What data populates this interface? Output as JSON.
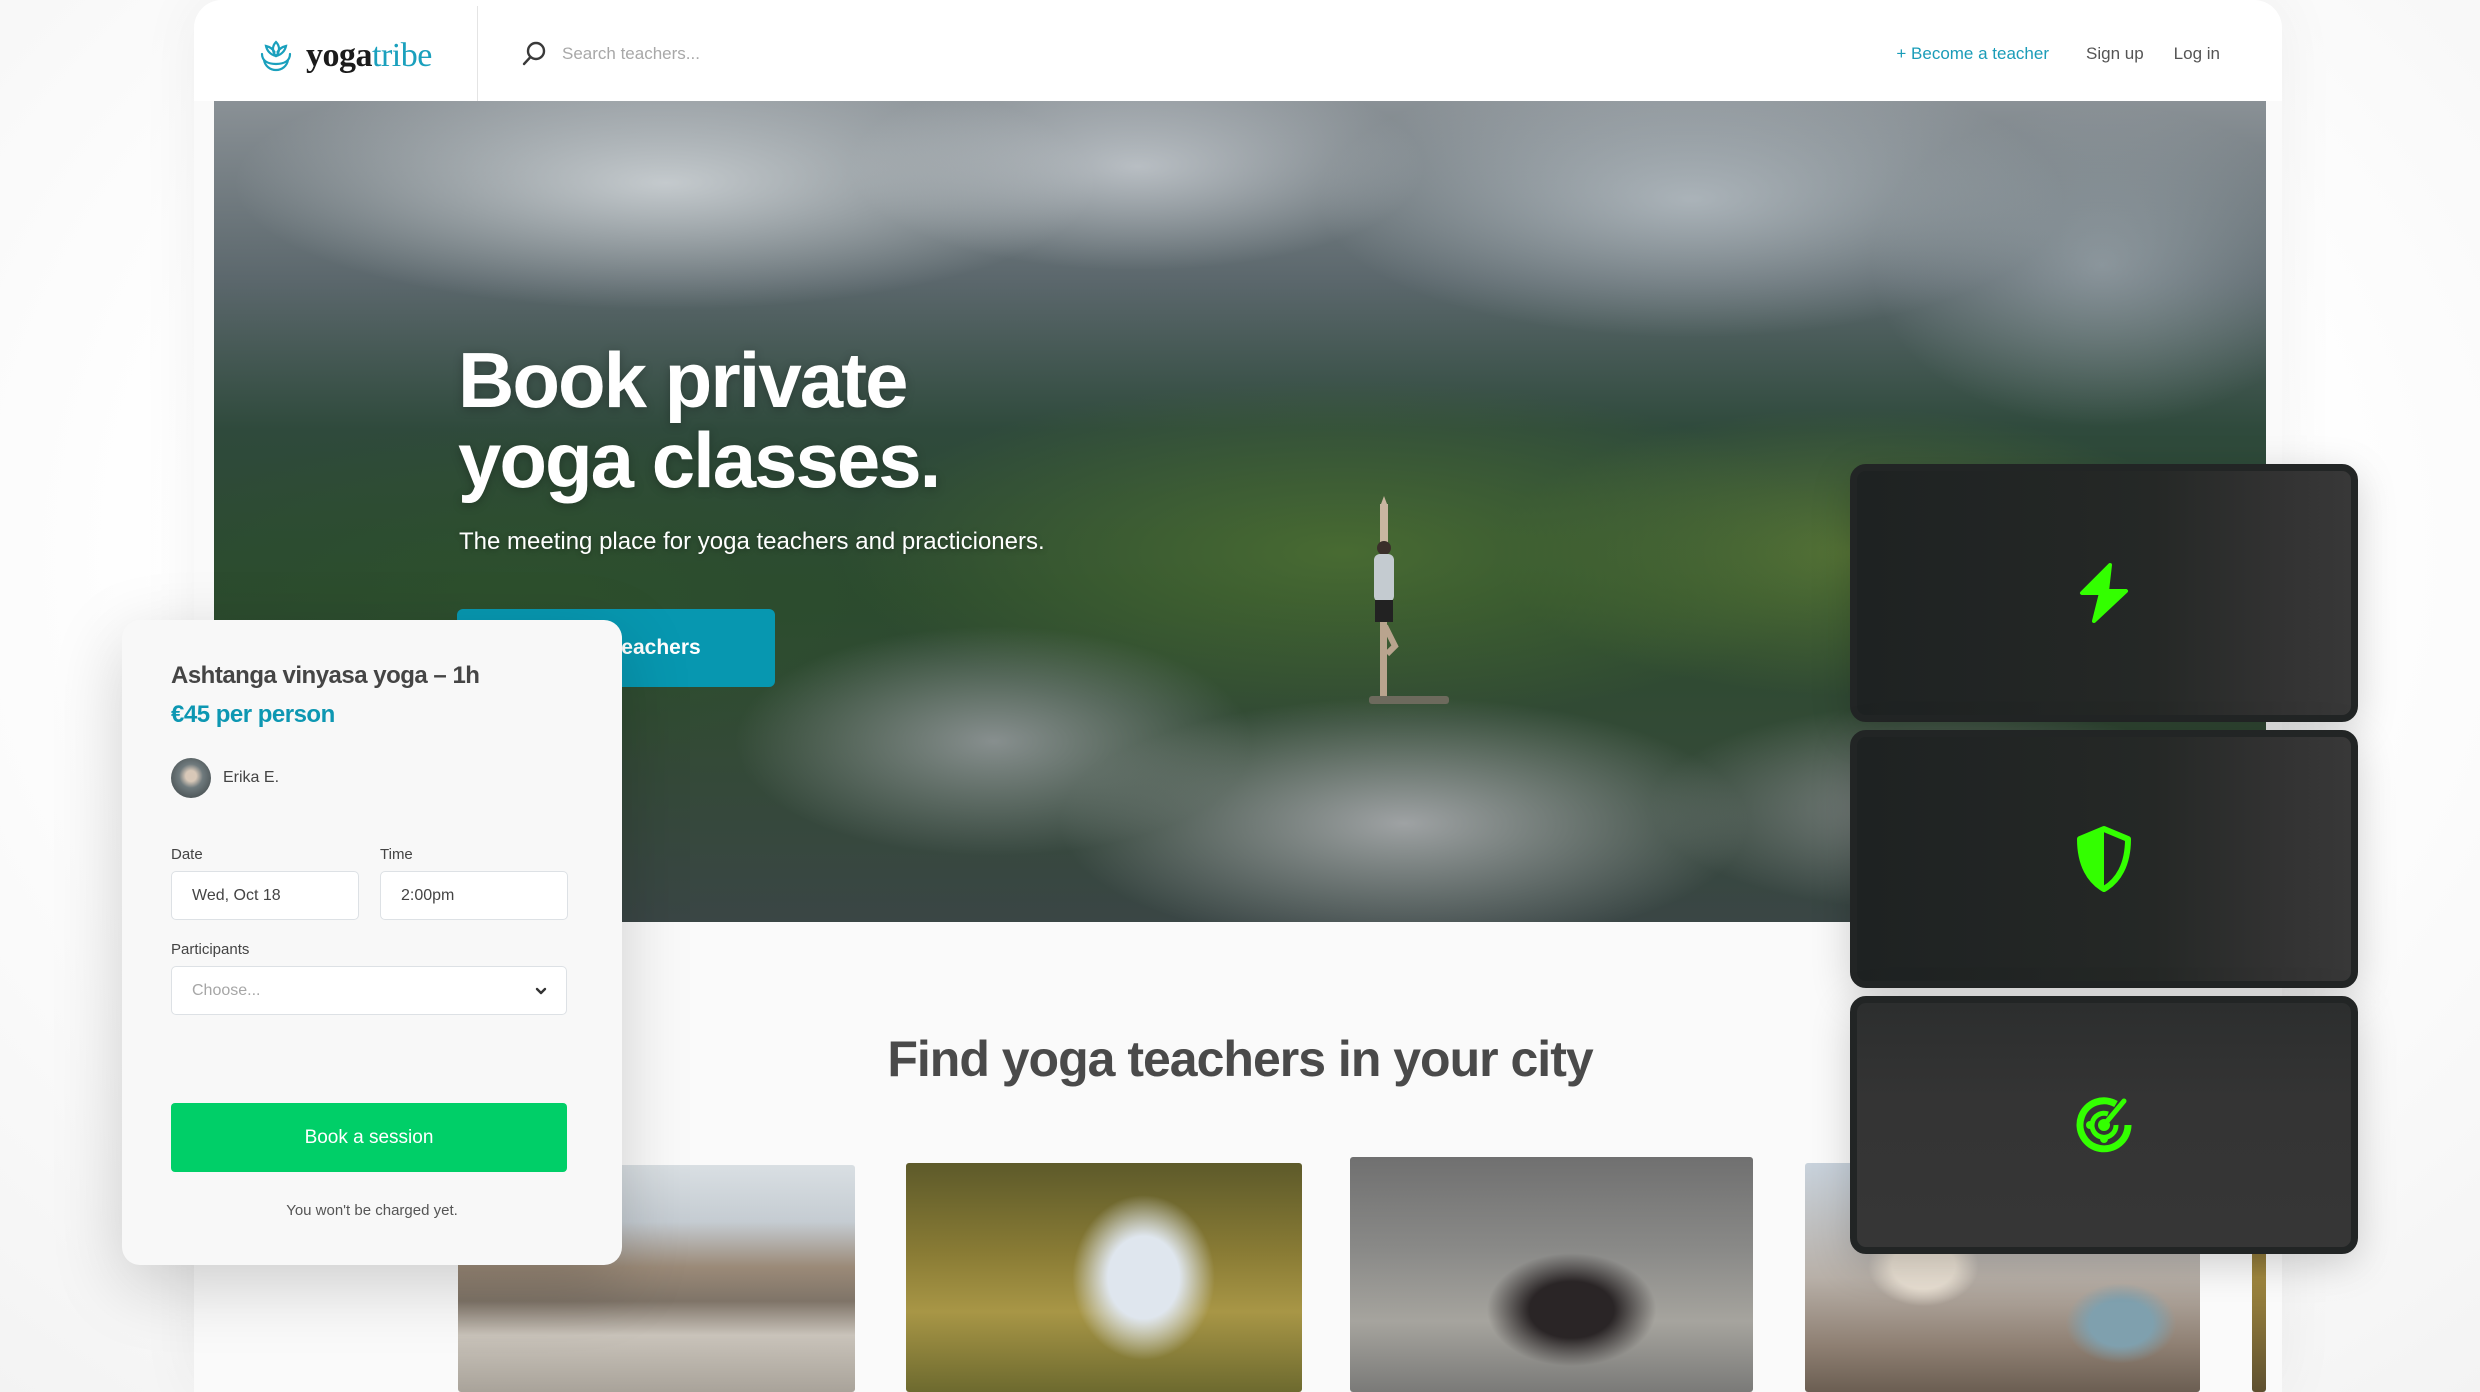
{
  "header": {
    "logo": {
      "text_primary": "yoga",
      "text_accent": "tribe",
      "icon": "lotus-icon"
    },
    "search": {
      "placeholder": "Search teachers...",
      "value": "",
      "icon": "search-icon"
    },
    "nav": {
      "become_teacher": "+ Become a teacher",
      "sign_up": "Sign up",
      "log_in": "Log in"
    }
  },
  "hero": {
    "title_line1": "Book private",
    "title_line2": "yoga classes.",
    "subtitle": "The meeting place for yoga teachers and practicioners.",
    "cta_visible_text": "eachers"
  },
  "booking": {
    "title": "Ashtanga vinyasa yoga – 1h",
    "price": "€45 per person",
    "teacher_name": "Erika E.",
    "date_label": "Date",
    "date_value": "Wed, Oct 18",
    "time_label": "Time",
    "time_value": "2:00pm",
    "participants_label": "Participants",
    "participants_placeholder": "Choose...",
    "button_label": "Book a session",
    "note": "You won't be charged yet."
  },
  "section": {
    "title": "Find yoga teachers in your city"
  },
  "feature_cards": [
    {
      "icon": "lightning-bolt-icon"
    },
    {
      "icon": "shield-icon"
    },
    {
      "icon": "radar-target-icon"
    }
  ],
  "colors": {
    "brand_teal": "#0797b0",
    "price_teal": "#0d97b2",
    "book_green": "#00cf68",
    "feature_icon_green": "#33ff00",
    "feature_card_dark": "#222525"
  }
}
